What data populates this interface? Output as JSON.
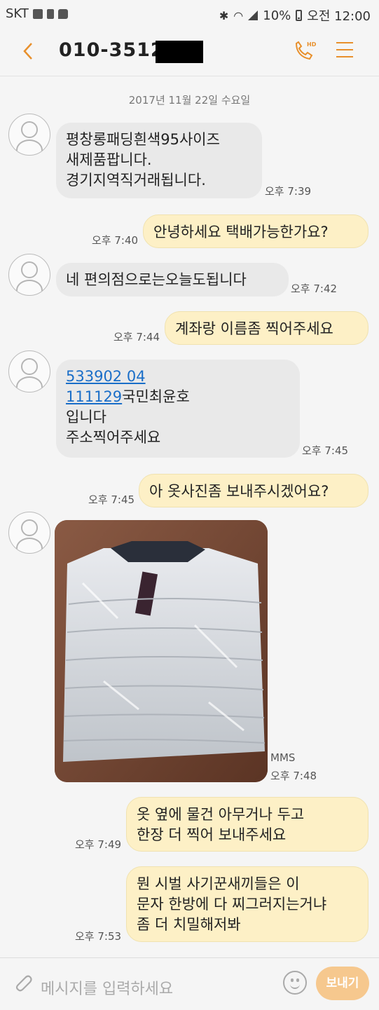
{
  "status_bar": {
    "carrier": "SKT",
    "battery": "10%",
    "time": "오전 12:00"
  },
  "header": {
    "contact_number": "010-3512-",
    "colors": {
      "accent": "#e8902c"
    }
  },
  "conversation": {
    "date": "2017년 11월 22일 수요일",
    "messages": [
      {
        "text": "평창롱패딩흰색95사이즈\n새제품팝니다.\n경기지역직거래됩니다.",
        "time": "오후 7:39"
      },
      {
        "text": "안녕하세요 택배가능한가요?",
        "time": "오후 7:40"
      },
      {
        "text": "네 편의점으로는오늘도됩니다",
        "time": "오후 7:42"
      },
      {
        "text": "계좌랑 이름좀 찍어주세요",
        "time": "오후 7:44"
      },
      {
        "link1": "533902 04",
        "link2": "111129",
        "rest": "국민최윤호\n입니다\n주소찍어주세요",
        "time": "오후 7:45"
      },
      {
        "text": "아 옷사진좀 보내주시겠어요?",
        "time": "오후 7:45"
      },
      {
        "mms_label": "MMS",
        "time": "오후 7:48"
      },
      {
        "text": "옷 옆에 물건 아무거나 두고\n한장 더 찍어 보내주세요",
        "time": "오후 7:49"
      },
      {
        "text": "뭔 시벌 사기꾼새끼들은 이\n문자 한방에 다 찌그러지는거냐\n좀 더 치밀해저봐",
        "time": "오후 7:53"
      }
    ]
  },
  "composer": {
    "placeholder": "메시지를 입력하세요",
    "send_label": "보내기"
  }
}
